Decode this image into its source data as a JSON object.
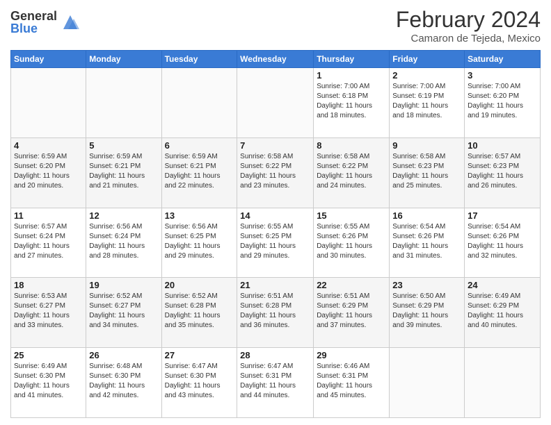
{
  "header": {
    "logo_general": "General",
    "logo_blue": "Blue",
    "month_year": "February 2024",
    "location": "Camaron de Tejeda, Mexico"
  },
  "weekdays": [
    "Sunday",
    "Monday",
    "Tuesday",
    "Wednesday",
    "Thursday",
    "Friday",
    "Saturday"
  ],
  "weeks": [
    [
      {
        "day": "",
        "info": ""
      },
      {
        "day": "",
        "info": ""
      },
      {
        "day": "",
        "info": ""
      },
      {
        "day": "",
        "info": ""
      },
      {
        "day": "1",
        "info": "Sunrise: 7:00 AM\nSunset: 6:18 PM\nDaylight: 11 hours\nand 18 minutes."
      },
      {
        "day": "2",
        "info": "Sunrise: 7:00 AM\nSunset: 6:19 PM\nDaylight: 11 hours\nand 18 minutes."
      },
      {
        "day": "3",
        "info": "Sunrise: 7:00 AM\nSunset: 6:20 PM\nDaylight: 11 hours\nand 19 minutes."
      }
    ],
    [
      {
        "day": "4",
        "info": "Sunrise: 6:59 AM\nSunset: 6:20 PM\nDaylight: 11 hours\nand 20 minutes."
      },
      {
        "day": "5",
        "info": "Sunrise: 6:59 AM\nSunset: 6:21 PM\nDaylight: 11 hours\nand 21 minutes."
      },
      {
        "day": "6",
        "info": "Sunrise: 6:59 AM\nSunset: 6:21 PM\nDaylight: 11 hours\nand 22 minutes."
      },
      {
        "day": "7",
        "info": "Sunrise: 6:58 AM\nSunset: 6:22 PM\nDaylight: 11 hours\nand 23 minutes."
      },
      {
        "day": "8",
        "info": "Sunrise: 6:58 AM\nSunset: 6:22 PM\nDaylight: 11 hours\nand 24 minutes."
      },
      {
        "day": "9",
        "info": "Sunrise: 6:58 AM\nSunset: 6:23 PM\nDaylight: 11 hours\nand 25 minutes."
      },
      {
        "day": "10",
        "info": "Sunrise: 6:57 AM\nSunset: 6:23 PM\nDaylight: 11 hours\nand 26 minutes."
      }
    ],
    [
      {
        "day": "11",
        "info": "Sunrise: 6:57 AM\nSunset: 6:24 PM\nDaylight: 11 hours\nand 27 minutes."
      },
      {
        "day": "12",
        "info": "Sunrise: 6:56 AM\nSunset: 6:24 PM\nDaylight: 11 hours\nand 28 minutes."
      },
      {
        "day": "13",
        "info": "Sunrise: 6:56 AM\nSunset: 6:25 PM\nDaylight: 11 hours\nand 29 minutes."
      },
      {
        "day": "14",
        "info": "Sunrise: 6:55 AM\nSunset: 6:25 PM\nDaylight: 11 hours\nand 29 minutes."
      },
      {
        "day": "15",
        "info": "Sunrise: 6:55 AM\nSunset: 6:26 PM\nDaylight: 11 hours\nand 30 minutes."
      },
      {
        "day": "16",
        "info": "Sunrise: 6:54 AM\nSunset: 6:26 PM\nDaylight: 11 hours\nand 31 minutes."
      },
      {
        "day": "17",
        "info": "Sunrise: 6:54 AM\nSunset: 6:26 PM\nDaylight: 11 hours\nand 32 minutes."
      }
    ],
    [
      {
        "day": "18",
        "info": "Sunrise: 6:53 AM\nSunset: 6:27 PM\nDaylight: 11 hours\nand 33 minutes."
      },
      {
        "day": "19",
        "info": "Sunrise: 6:52 AM\nSunset: 6:27 PM\nDaylight: 11 hours\nand 34 minutes."
      },
      {
        "day": "20",
        "info": "Sunrise: 6:52 AM\nSunset: 6:28 PM\nDaylight: 11 hours\nand 35 minutes."
      },
      {
        "day": "21",
        "info": "Sunrise: 6:51 AM\nSunset: 6:28 PM\nDaylight: 11 hours\nand 36 minutes."
      },
      {
        "day": "22",
        "info": "Sunrise: 6:51 AM\nSunset: 6:29 PM\nDaylight: 11 hours\nand 37 minutes."
      },
      {
        "day": "23",
        "info": "Sunrise: 6:50 AM\nSunset: 6:29 PM\nDaylight: 11 hours\nand 39 minutes."
      },
      {
        "day": "24",
        "info": "Sunrise: 6:49 AM\nSunset: 6:29 PM\nDaylight: 11 hours\nand 40 minutes."
      }
    ],
    [
      {
        "day": "25",
        "info": "Sunrise: 6:49 AM\nSunset: 6:30 PM\nDaylight: 11 hours\nand 41 minutes."
      },
      {
        "day": "26",
        "info": "Sunrise: 6:48 AM\nSunset: 6:30 PM\nDaylight: 11 hours\nand 42 minutes."
      },
      {
        "day": "27",
        "info": "Sunrise: 6:47 AM\nSunset: 6:30 PM\nDaylight: 11 hours\nand 43 minutes."
      },
      {
        "day": "28",
        "info": "Sunrise: 6:47 AM\nSunset: 6:31 PM\nDaylight: 11 hours\nand 44 minutes."
      },
      {
        "day": "29",
        "info": "Sunrise: 6:46 AM\nSunset: 6:31 PM\nDaylight: 11 hours\nand 45 minutes."
      },
      {
        "day": "",
        "info": ""
      },
      {
        "day": "",
        "info": ""
      }
    ]
  ]
}
